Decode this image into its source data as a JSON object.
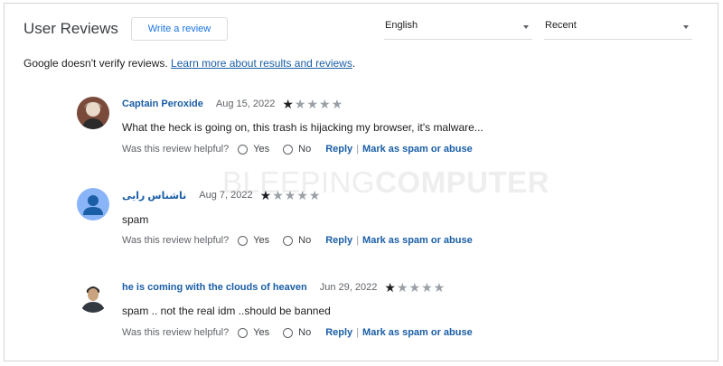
{
  "header": {
    "title": "User Reviews",
    "write_review_label": "Write a review",
    "language_select": "English",
    "sort_select": "Recent"
  },
  "disclaimer": {
    "text": "Google doesn't verify reviews.",
    "link": "Learn more about results and reviews",
    "suffix": "."
  },
  "watermark": {
    "light": "BLEEPING",
    "bold": "COMPUTER"
  },
  "helpful_prompt": "Was this review helpful?",
  "yes_label": "Yes",
  "no_label": "No",
  "reply_label": "Reply",
  "spam_label": "Mark as spam or abuse",
  "reviews": [
    {
      "author": "Captain Peroxide",
      "date": "Aug 15, 2022",
      "rating": 1,
      "text": "What the heck is going on, this trash is hijacking my browser, it's malware...",
      "avatar": "photo"
    },
    {
      "author": "ناشناس رایی",
      "date": "Aug 7, 2022",
      "rating": 1,
      "text": "spam",
      "avatar": "default-person-icon"
    },
    {
      "author": "he is coming with the clouds of heaven",
      "date": "Jun 29, 2022",
      "rating": 1,
      "text": "spam .. not the real idm ..should be banned",
      "avatar": "photo"
    }
  ],
  "colors": {
    "link": "#1a5ea6",
    "button_text": "#1a73e8",
    "default_avatar": "#8ab4f8"
  }
}
